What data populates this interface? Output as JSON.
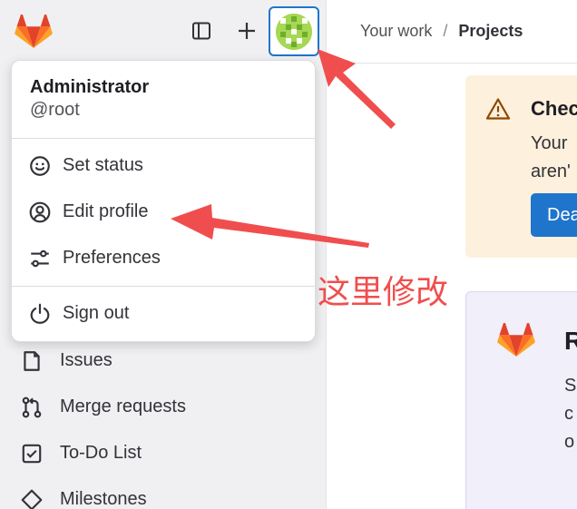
{
  "header": {
    "breadcrumb": [
      "Your work",
      "Projects"
    ],
    "separator": "/"
  },
  "topbar": {
    "toggle_icon": "sidebar-toggle-icon",
    "new_icon": "plus-icon",
    "avatar_icon": "identicon-avatar"
  },
  "user_menu": {
    "name": "Administrator",
    "username": "@root",
    "items": [
      {
        "label": "Set status",
        "icon": "smiley-icon"
      },
      {
        "label": "Edit profile",
        "icon": "user-circle-icon"
      },
      {
        "label": "Preferences",
        "icon": "preferences-icon"
      }
    ],
    "sign_out": {
      "label": "Sign out",
      "icon": "power-icon"
    }
  },
  "sidebar": {
    "items": [
      {
        "label": "Issues",
        "icon": "issues-icon"
      },
      {
        "label": "Merge requests",
        "icon": "merge-request-icon"
      },
      {
        "label": "To-Do List",
        "icon": "todo-checkbox-icon"
      },
      {
        "label": "Milestones",
        "icon": "milestone-diamond-icon"
      }
    ]
  },
  "alert": {
    "title": "Chec",
    "lines": [
      "Your",
      "aren'"
    ],
    "button": "Dea",
    "icon": "warning-icon"
  },
  "promo": {
    "title": "R",
    "lines": [
      "S",
      "c",
      "o"
    ]
  },
  "annotation": {
    "text": "这里修改",
    "color": "#f04e4e"
  },
  "colors": {
    "accent": "#1f75cb",
    "alert_bg": "#fdf1dd",
    "sidebar_bg": "#f0f0f2",
    "annotation": "#f04e4e"
  }
}
